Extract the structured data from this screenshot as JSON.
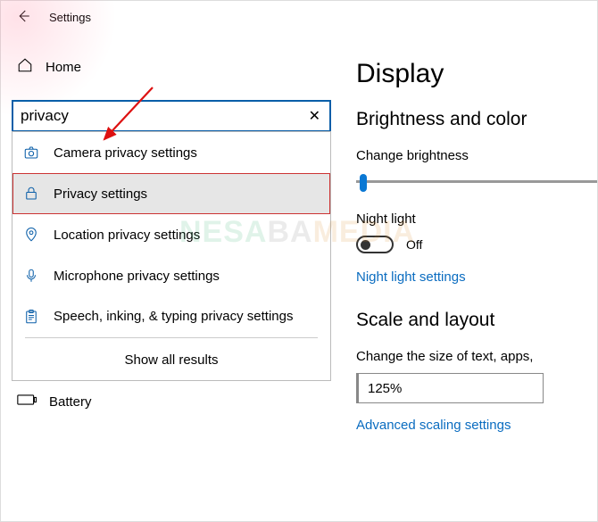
{
  "window": {
    "title": "Settings"
  },
  "home": {
    "label": "Home"
  },
  "search": {
    "value": "privacy"
  },
  "results": [
    {
      "label": "Camera privacy settings"
    },
    {
      "label": "Privacy settings"
    },
    {
      "label": "Location privacy settings"
    },
    {
      "label": "Microphone privacy settings"
    },
    {
      "label": "Speech, inking, & typing privacy settings"
    }
  ],
  "show_all": "Show all results",
  "battery": {
    "label": "Battery"
  },
  "right": {
    "heading": "Display",
    "section1": "Brightness and color",
    "brightness_label": "Change brightness",
    "nightlight_label": "Night light",
    "nightlight_state": "Off",
    "nightlight_link": "Night light settings",
    "section2": "Scale and layout",
    "scale_label": "Change the size of text, apps,",
    "scale_value": "125%",
    "advanced_link": "Advanced scaling settings"
  }
}
